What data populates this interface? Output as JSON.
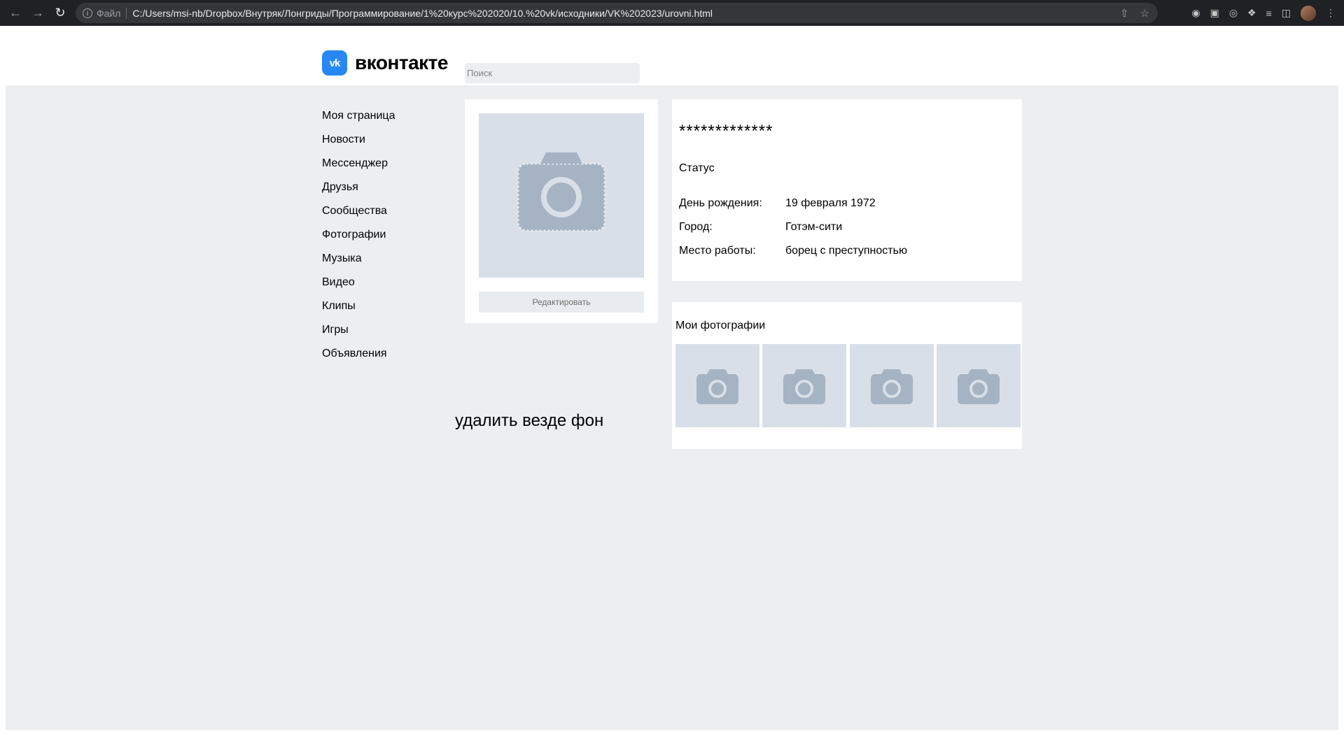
{
  "browser": {
    "file_label": "Файл",
    "url": "C:/Users/msi-nb/Dropbox/Внутряк/Лонгриды/Программирование/1%20курс%202020/10.%20vk/исходники/VK%202023/urovni.html"
  },
  "header": {
    "logo_mark": "vk",
    "logo_text": "вконтакте",
    "search_placeholder": "Поиск"
  },
  "sidebar": {
    "items": [
      {
        "label": "Моя страница"
      },
      {
        "label": "Новости"
      },
      {
        "label": "Мессенджер"
      },
      {
        "label": "Друзья"
      },
      {
        "label": "Сообщества"
      },
      {
        "label": "Фотографии"
      },
      {
        "label": "Музыка"
      },
      {
        "label": "Видео"
      },
      {
        "label": "Клипы"
      },
      {
        "label": "Игры"
      },
      {
        "label": "Объявления"
      }
    ]
  },
  "profile": {
    "edit_label": "Редактировать",
    "name": "*************",
    "status": "Статус",
    "details": [
      {
        "key": "День рождения:",
        "value": "19 февраля 1972"
      },
      {
        "key": "Город:",
        "value": "Готэм-сити"
      },
      {
        "key": "Место работы:",
        "value": "борец с преступностью"
      }
    ]
  },
  "photos": {
    "title": "Мои фотографии",
    "count": 4
  },
  "note": "удалить везде фон",
  "colors": {
    "vk_blue": "#2787f5",
    "background": "#edeef0",
    "placeholder_bg": "#d8dfe8",
    "camera_icon": "#a6b3c2"
  }
}
